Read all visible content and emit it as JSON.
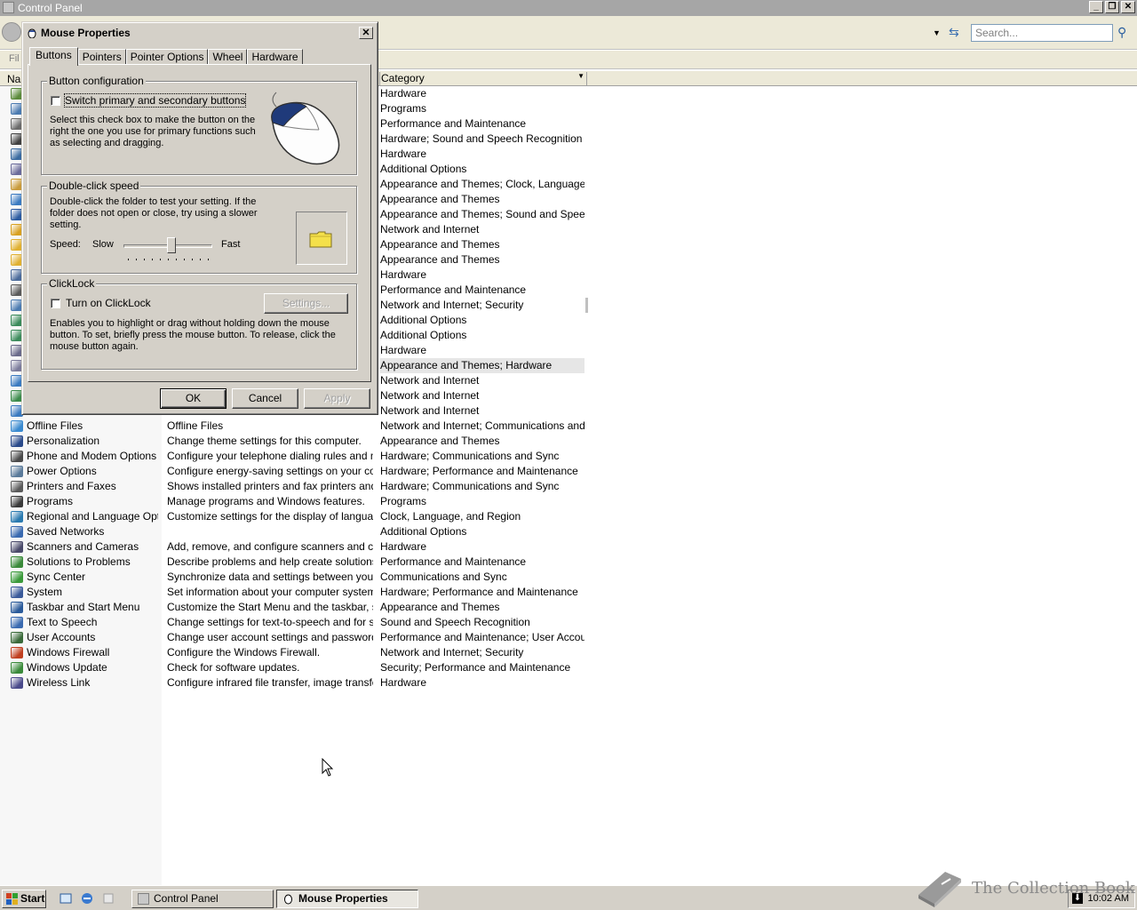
{
  "main_window": {
    "title": "Control Panel",
    "search_placeholder": "Search...",
    "menu_file": "Fil",
    "header_name": "Na",
    "header_category": "Category"
  },
  "rows": [
    {
      "name": "",
      "desc": "",
      "cat": "Hardware",
      "icon": "generic-icon",
      "color": "#5a8a3a"
    },
    {
      "name": "",
      "desc": "",
      "cat": "Programs",
      "icon": "generic-icon",
      "color": "#4a7ab0"
    },
    {
      "name": "",
      "desc": "",
      "cat": "Performance and Maintenance",
      "icon": "generic-icon",
      "color": "#6a6a6a"
    },
    {
      "name": "",
      "desc": "",
      "cat": "Hardware; Sound and Speech Recognition",
      "icon": "generic-icon",
      "color": "#404040"
    },
    {
      "name": "",
      "desc": "",
      "cat": "Hardware",
      "icon": "generic-icon",
      "color": "#3a6aa0"
    },
    {
      "name": "",
      "desc": "",
      "cat": "Additional Options",
      "icon": "generic-icon",
      "color": "#6a6a9a"
    },
    {
      "name": "",
      "desc": "",
      "cat": "Appearance and Themes; Clock, Language, a...",
      "icon": "generic-icon",
      "color": "#c89a3a"
    },
    {
      "name": "",
      "desc": "",
      "cat": "Appearance and Themes",
      "icon": "generic-icon",
      "color": "#3a7ac0"
    },
    {
      "name": "",
      "desc": "",
      "cat": "Appearance and Themes; Sound and Speech...",
      "icon": "generic-icon",
      "color": "#2a5aa0"
    },
    {
      "name": "",
      "desc": "",
      "cat": "Network and Internet",
      "icon": "generic-icon",
      "color": "#d8a020"
    },
    {
      "name": "",
      "desc": "",
      "cat": "Appearance and Themes",
      "icon": "generic-icon",
      "color": "#e0b030"
    },
    {
      "name": "",
      "desc": "",
      "cat": "Appearance and Themes",
      "icon": "generic-icon",
      "color": "#e0b030"
    },
    {
      "name": "",
      "desc": "",
      "cat": "Hardware",
      "icon": "generic-icon",
      "color": "#4a6a9a"
    },
    {
      "name": "",
      "desc": "",
      "cat": "Performance and Maintenance",
      "icon": "generic-icon",
      "color": "#5a5a5a"
    },
    {
      "name": "",
      "desc": "",
      "cat": "Network and Internet; Security",
      "icon": "generic-icon",
      "color": "#4a7ab0"
    },
    {
      "name": "",
      "desc": "",
      "cat": "Additional Options",
      "icon": "generic-icon",
      "color": "#3a8a5a"
    },
    {
      "name": "",
      "desc": "",
      "cat": "Additional Options",
      "icon": "generic-icon",
      "color": "#3a8a5a"
    },
    {
      "name": "",
      "desc": "",
      "cat": "Hardware",
      "icon": "generic-icon",
      "color": "#6a6a8a"
    },
    {
      "name": "",
      "desc": "",
      "cat": "Appearance and Themes; Hardware",
      "icon": "generic-icon",
      "color": "#7a7a9a"
    },
    {
      "name": "",
      "desc": "",
      "cat": "Network and Internet",
      "icon": "generic-icon",
      "color": "#3a7ac0"
    },
    {
      "name": "",
      "desc": "",
      "cat": "Network and Internet",
      "icon": "generic-icon",
      "color": "#3a8a4a"
    },
    {
      "name": "",
      "desc": "",
      "cat": "Network and Internet",
      "icon": "generic-icon",
      "color": "#3a7ac0"
    },
    {
      "name": "Offline Files",
      "desc": "Offline Files",
      "cat": "Network and Internet; Communications and Sy...",
      "icon": "offline-files-icon",
      "color": "#3a8ad0"
    },
    {
      "name": "Personalization",
      "desc": "Change theme settings for this computer.",
      "cat": "Appearance and Themes",
      "icon": "personalization-icon",
      "color": "#2a4a8a"
    },
    {
      "name": "Phone and Modem Options",
      "desc": "Configure your telephone dialing rules and mo...",
      "cat": "Hardware; Communications and Sync",
      "icon": "phone-icon",
      "color": "#4a4a4a"
    },
    {
      "name": "Power Options",
      "desc": "Configure energy-saving settings on your com...",
      "cat": "Hardware; Performance and Maintenance",
      "icon": "power-icon",
      "color": "#5a7a9a"
    },
    {
      "name": "Printers and Faxes",
      "desc": "Shows installed printers and fax printers and h...",
      "cat": "Hardware; Communications and Sync",
      "icon": "printer-icon",
      "color": "#5a5a5a"
    },
    {
      "name": "Programs",
      "desc": "Manage programs and Windows features.",
      "cat": "Programs",
      "icon": "programs-icon",
      "color": "#3a3a3a"
    },
    {
      "name": "Regional and Language Opti...",
      "desc": "Customize settings for the display of languages...",
      "cat": "Clock, Language, and Region",
      "icon": "globe-icon",
      "color": "#2a7ab0"
    },
    {
      "name": "Saved Networks",
      "desc": "",
      "cat": "Additional Options",
      "icon": "network-icon",
      "color": "#3a6ab0"
    },
    {
      "name": "Scanners and Cameras",
      "desc": "Add, remove, and configure scanners and ca...",
      "cat": "Hardware",
      "icon": "scanner-icon",
      "color": "#4a4a6a"
    },
    {
      "name": "Solutions to Problems",
      "desc": "Describe problems and help create solutions w...",
      "cat": "Performance and Maintenance",
      "icon": "solutions-icon",
      "color": "#3a8a3a"
    },
    {
      "name": "Sync Center",
      "desc": "Synchronize data and settings between your c...",
      "cat": "Communications and Sync",
      "icon": "sync-icon",
      "color": "#3a9a3a"
    },
    {
      "name": "System",
      "desc": "Set information about your computer system, a...",
      "cat": "Hardware; Performance and Maintenance",
      "icon": "system-icon",
      "color": "#3a5a9a"
    },
    {
      "name": "Taskbar and Start Menu",
      "desc": "Customize the Start Menu and the taskbar, su...",
      "cat": "Appearance and Themes",
      "icon": "taskbar-icon",
      "color": "#2a5a9a"
    },
    {
      "name": "Text to Speech",
      "desc": "Change settings for text-to-speech and for spe...",
      "cat": "Sound and Speech Recognition",
      "icon": "speech-icon",
      "color": "#3a6ab0"
    },
    {
      "name": "User Accounts",
      "desc": "Change user account settings and passwords ...",
      "cat": "Performance and Maintenance; User Account...",
      "icon": "users-icon",
      "color": "#3a6a3a"
    },
    {
      "name": "Windows Firewall",
      "desc": "Configure the Windows Firewall.",
      "cat": "Network and Internet; Security",
      "icon": "firewall-icon",
      "color": "#c04020"
    },
    {
      "name": "Windows Update",
      "desc": "Check for software updates.",
      "cat": "Security; Performance and Maintenance",
      "icon": "update-icon",
      "color": "#3a8a3a"
    },
    {
      "name": "Wireless Link",
      "desc": "Configure infrared file transfer, image transfer, ...",
      "cat": "Hardware",
      "icon": "wireless-icon",
      "color": "#4a4a8a"
    }
  ],
  "dialog": {
    "title": "Mouse Properties",
    "tabs": [
      "Buttons",
      "Pointers",
      "Pointer Options",
      "Wheel",
      "Hardware"
    ],
    "active_tab": "Buttons",
    "button_config": {
      "legend": "Button configuration",
      "checkbox_label": "Switch primary and secondary buttons",
      "checked": false,
      "description": "Select this check box to make the button on the right the one you use for primary functions such as selecting and dragging."
    },
    "double_click": {
      "legend": "Double-click speed",
      "description": "Double-click the folder to test your setting. If the folder does not open or close, try using a slower setting.",
      "speed_label": "Speed:",
      "slow_label": "Slow",
      "fast_label": "Fast",
      "speed_level": 0.6
    },
    "clicklock": {
      "legend": "ClickLock",
      "checkbox_label": "Turn on ClickLock",
      "checked": false,
      "settings_button": "Settings...",
      "description": "Enables you to highlight or drag without holding down the mouse button. To set, briefly press the mouse button. To release, click the mouse button again."
    },
    "ok_label": "OK",
    "cancel_label": "Cancel",
    "apply_label": "Apply"
  },
  "taskbar": {
    "start_label": "Start",
    "tasks": [
      "Control Panel",
      "Mouse Properties"
    ],
    "active_task": "Mouse Properties",
    "clock": "10:02 AM"
  },
  "watermark": {
    "text": "The Collection Book"
  }
}
